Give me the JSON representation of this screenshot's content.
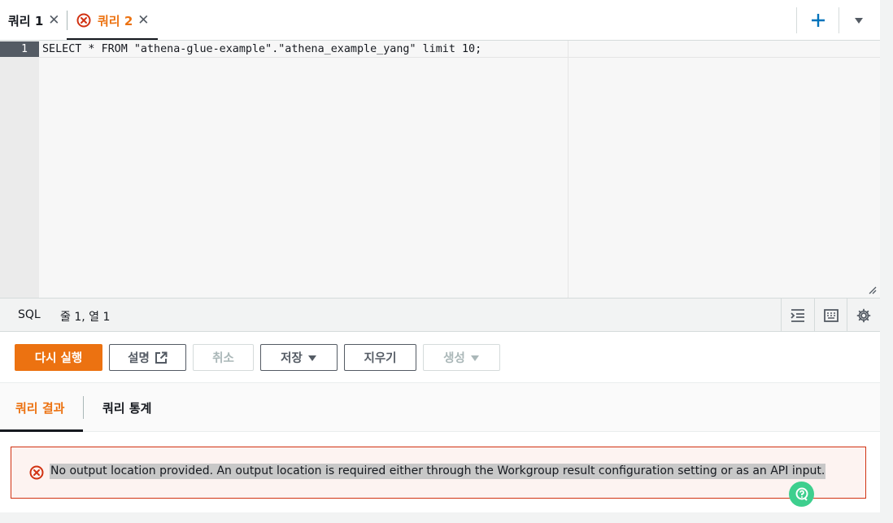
{
  "tabs": [
    {
      "label": "쿼리 1",
      "state": "normal"
    },
    {
      "label": "쿼리 2",
      "state": "error"
    }
  ],
  "editor": {
    "line_number": "1",
    "code": {
      "kw_select": "SELECT",
      "star": " * ",
      "kw_from": "FROM",
      "space": " ",
      "db": "\"athena-glue-example\"",
      "dot": ".",
      "table": "\"athena_example_yang\"",
      "kw_limit": " limit ",
      "num": "10",
      "semi": ";"
    }
  },
  "status": {
    "language": "SQL",
    "position": "줄 1, 열 1"
  },
  "actions": {
    "run_again": "다시 실행",
    "explain": "설명",
    "cancel": "취소",
    "save": "저장",
    "clear": "지우기",
    "create": "생성"
  },
  "results": {
    "tab_results": "쿼리 결과",
    "tab_stats": "쿼리 통계",
    "error_message": "No output location provided. An output location is required either through the Workgroup result configuration setting or as an API input."
  },
  "colors": {
    "accent": "#ec7211",
    "error": "#d13212",
    "link_blue": "#0073bb"
  },
  "icons": [
    "close-icon",
    "error-icon",
    "plus-icon",
    "caret-down-icon",
    "external-link-icon",
    "indent-icon",
    "keyboard-icon",
    "gear-icon",
    "resize-icon",
    "help-bubble-icon"
  ]
}
